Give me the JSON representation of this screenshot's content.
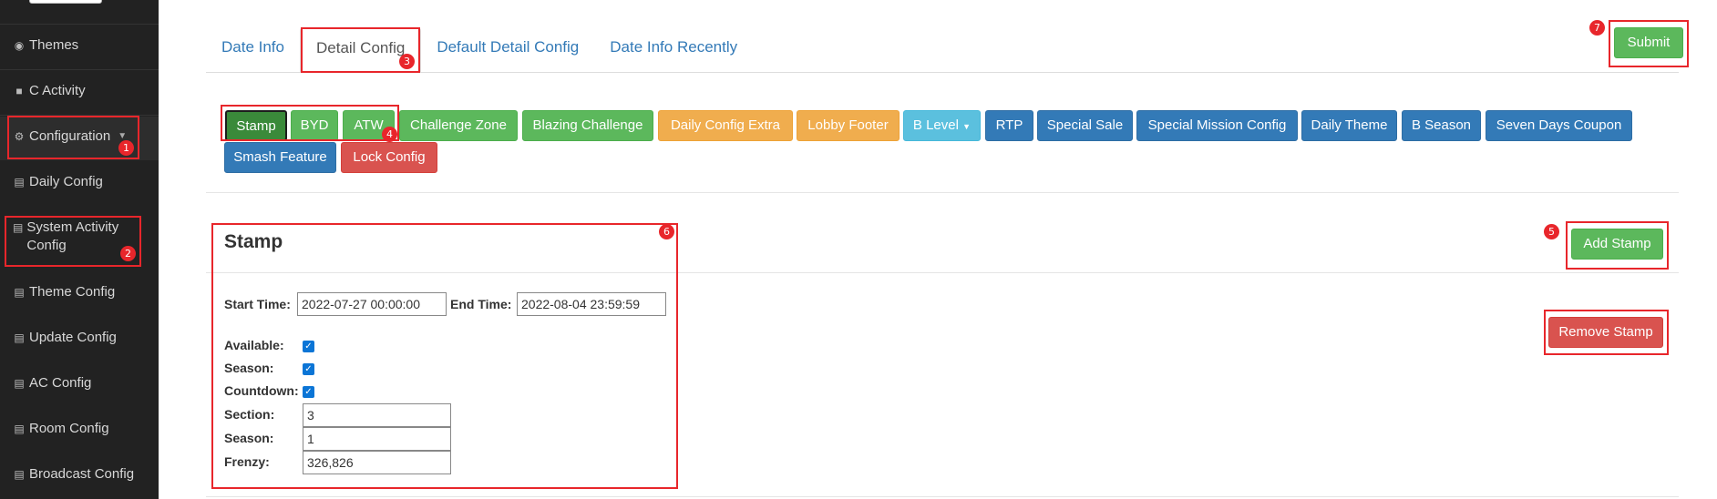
{
  "sidebar": {
    "items": [
      {
        "label": "Themes",
        "icon": "gamepad-icon"
      },
      {
        "label": "C Activity",
        "icon": "book-icon"
      },
      {
        "label": "Configuration",
        "icon": "gear-icon"
      },
      {
        "label": "Daily Config",
        "icon": "list-icon"
      },
      {
        "label": "System Activity Config",
        "icon": "list-icon"
      },
      {
        "label": "Theme Config",
        "icon": "list-icon"
      },
      {
        "label": "Update Config",
        "icon": "list-icon"
      },
      {
        "label": "AC Config",
        "icon": "list-icon"
      },
      {
        "label": "Room Config",
        "icon": "list-icon"
      },
      {
        "label": "Broadcast Config",
        "icon": "list-icon"
      }
    ]
  },
  "tabs": [
    {
      "label": "Date Info"
    },
    {
      "label": "Detail Config"
    },
    {
      "label": "Default Detail Config"
    },
    {
      "label": "Date Info Recently"
    }
  ],
  "submit_label": "Submit",
  "config_buttons": [
    {
      "label": "Stamp"
    },
    {
      "label": "BYD"
    },
    {
      "label": "ATW"
    },
    {
      "label": "Challenge Zone"
    },
    {
      "label": "Blazing Challenge"
    },
    {
      "label": "Daily Config Extra"
    },
    {
      "label": "Lobby Footer"
    },
    {
      "label": "B Level"
    },
    {
      "label": "RTP"
    },
    {
      "label": "Special Sale"
    },
    {
      "label": "Special Mission Config"
    },
    {
      "label": "Daily Theme"
    },
    {
      "label": "B Season"
    },
    {
      "label": "Seven Days Coupon"
    },
    {
      "label": "Smash Feature"
    },
    {
      "label": "Lock Config"
    }
  ],
  "stamp": {
    "title": "Stamp",
    "add_label": "Add Stamp",
    "remove_label": "Remove Stamp",
    "start_time_label": "Start Time:",
    "start_time": "2022-07-27 00:00:00",
    "end_time_label": "End Time:",
    "end_time": "2022-08-04 23:59:59",
    "available_label": "Available:",
    "season_check_label": "Season:",
    "countdown_label": "Countdown:",
    "section_label": "Section:",
    "section_value": "3",
    "season_label": "Season:",
    "season_value": "1",
    "frenzy_label": "Frenzy:",
    "frenzy_value": "326,826"
  },
  "annotations": [
    "1",
    "2",
    "3",
    "4",
    "5",
    "6",
    "7"
  ],
  "colors": {
    "sidebar_bg": "#222222",
    "link": "#337ab7",
    "success": "#5cb85c",
    "warning": "#f0ad4e",
    "info": "#5bc0de",
    "danger": "#d9534f",
    "annotation": "#e8262b"
  }
}
